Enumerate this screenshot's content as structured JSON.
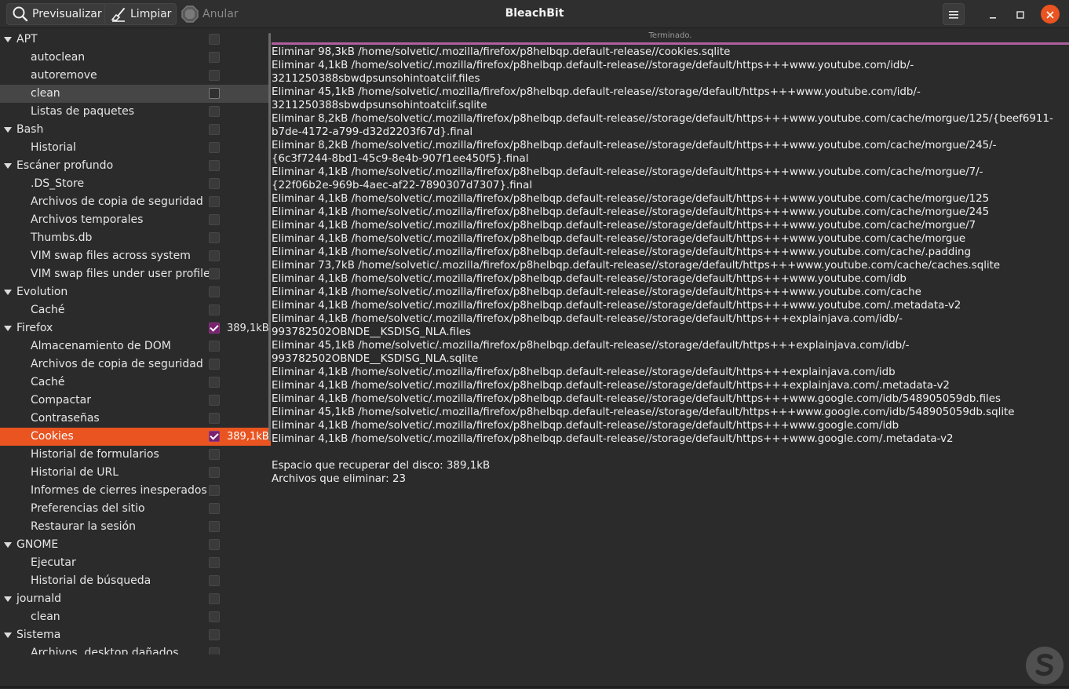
{
  "window": {
    "title": "BleachBit"
  },
  "toolbar": {
    "preview_label": "Previsualizar",
    "clean_label": "Limpiar",
    "abort_label": "Anular"
  },
  "status": {
    "text": "Terminado.",
    "progress": 1.0
  },
  "tree": [
    {
      "type": "parent",
      "label": "APT",
      "checked": false,
      "size": ""
    },
    {
      "type": "child",
      "label": "autoclean",
      "checked": false,
      "size": ""
    },
    {
      "type": "child",
      "label": "autoremove",
      "checked": false,
      "size": ""
    },
    {
      "type": "child",
      "label": "clean",
      "checked": false,
      "size": "",
      "selected": "grey"
    },
    {
      "type": "child",
      "label": "Listas de paquetes",
      "checked": false,
      "size": ""
    },
    {
      "type": "parent",
      "label": "Bash",
      "checked": false,
      "size": ""
    },
    {
      "type": "child",
      "label": "Historial",
      "checked": false,
      "size": ""
    },
    {
      "type": "parent",
      "label": "Escáner profundo",
      "checked": false,
      "size": ""
    },
    {
      "type": "child",
      "label": ".DS_Store",
      "checked": false,
      "size": ""
    },
    {
      "type": "child",
      "label": "Archivos de copia de seguridad",
      "checked": false,
      "size": ""
    },
    {
      "type": "child",
      "label": "Archivos temporales",
      "checked": false,
      "size": ""
    },
    {
      "type": "child",
      "label": "Thumbs.db",
      "checked": false,
      "size": ""
    },
    {
      "type": "child",
      "label": "VIM swap files across system",
      "checked": false,
      "size": ""
    },
    {
      "type": "child",
      "label": "VIM swap files under user profile",
      "checked": false,
      "size": ""
    },
    {
      "type": "parent",
      "label": "Evolution",
      "checked": false,
      "size": ""
    },
    {
      "type": "child",
      "label": "Caché",
      "checked": false,
      "size": ""
    },
    {
      "type": "parent",
      "label": "Firefox",
      "checked": true,
      "size": "389,1kB"
    },
    {
      "type": "child",
      "label": "Almacenamiento de DOM",
      "checked": false,
      "size": ""
    },
    {
      "type": "child",
      "label": "Archivos de copia de seguridad",
      "checked": false,
      "size": ""
    },
    {
      "type": "child",
      "label": "Caché",
      "checked": false,
      "size": ""
    },
    {
      "type": "child",
      "label": "Compactar",
      "checked": false,
      "size": ""
    },
    {
      "type": "child",
      "label": "Contraseñas",
      "checked": false,
      "size": ""
    },
    {
      "type": "child",
      "label": "Cookies",
      "checked": true,
      "size": "389,1kB",
      "selected": "orange"
    },
    {
      "type": "child",
      "label": "Historial de formularios",
      "checked": false,
      "size": ""
    },
    {
      "type": "child",
      "label": "Historial de URL",
      "checked": false,
      "size": ""
    },
    {
      "type": "child",
      "label": "Informes de cierres inesperados",
      "checked": false,
      "size": ""
    },
    {
      "type": "child",
      "label": "Preferencias del sitio",
      "checked": false,
      "size": ""
    },
    {
      "type": "child",
      "label": "Restaurar la sesión",
      "checked": false,
      "size": ""
    },
    {
      "type": "parent",
      "label": "GNOME",
      "checked": false,
      "size": ""
    },
    {
      "type": "child",
      "label": "Ejecutar",
      "checked": false,
      "size": ""
    },
    {
      "type": "child",
      "label": "Historial de búsqueda",
      "checked": false,
      "size": ""
    },
    {
      "type": "parent",
      "label": "journald",
      "checked": false,
      "size": ""
    },
    {
      "type": "child",
      "label": "clean",
      "checked": false,
      "size": ""
    },
    {
      "type": "parent",
      "label": "Sistema",
      "checked": false,
      "size": ""
    },
    {
      "type": "child",
      "label": "Archivos .desktop dañados",
      "checked": false,
      "size": ""
    }
  ],
  "log": {
    "lines": [
      "Eliminar 98,3kB /home/solvetic/.mozilla/firefox/p8helbqp.default-release//cookies.sqlite",
      "Eliminar 4,1kB /home/solvetic/.mozilla/firefox/p8helbqp.default-release//storage/default/https+++www.youtube.com/idb/-",
      "3211250388sbwdpsunsohintoatciif.files",
      "Eliminar 45,1kB /home/solvetic/.mozilla/firefox/p8helbqp.default-release//storage/default/https+++www.youtube.com/idb/-",
      "3211250388sbwdpsunsohintoatciif.sqlite",
      "Eliminar 8,2kB /home/solvetic/.mozilla/firefox/p8helbqp.default-release//storage/default/https+++www.youtube.com/cache/morgue/125/{beef6911-",
      "b7de-4172-a799-d32d2203f67d}.final",
      "Eliminar 8,2kB /home/solvetic/.mozilla/firefox/p8helbqp.default-release//storage/default/https+++www.youtube.com/cache/morgue/245/-",
      "{6c3f7244-8bd1-45c9-8e4b-907f1ee450f5}.final",
      "Eliminar 4,1kB /home/solvetic/.mozilla/firefox/p8helbqp.default-release//storage/default/https+++www.youtube.com/cache/morgue/7/-",
      "{22f06b2e-969b-4aec-af22-7890307d7307}.final",
      "Eliminar 4,1kB /home/solvetic/.mozilla/firefox/p8helbqp.default-release//storage/default/https+++www.youtube.com/cache/morgue/125",
      "Eliminar 4,1kB /home/solvetic/.mozilla/firefox/p8helbqp.default-release//storage/default/https+++www.youtube.com/cache/morgue/245",
      "Eliminar 4,1kB /home/solvetic/.mozilla/firefox/p8helbqp.default-release//storage/default/https+++www.youtube.com/cache/morgue/7",
      "Eliminar 4,1kB /home/solvetic/.mozilla/firefox/p8helbqp.default-release//storage/default/https+++www.youtube.com/cache/morgue",
      "Eliminar 4,1kB /home/solvetic/.mozilla/firefox/p8helbqp.default-release//storage/default/https+++www.youtube.com/cache/.padding",
      "Eliminar 73,7kB /home/solvetic/.mozilla/firefox/p8helbqp.default-release//storage/default/https+++www.youtube.com/cache/caches.sqlite",
      "Eliminar 4,1kB /home/solvetic/.mozilla/firefox/p8helbqp.default-release//storage/default/https+++www.youtube.com/idb",
      "Eliminar 4,1kB /home/solvetic/.mozilla/firefox/p8helbqp.default-release//storage/default/https+++www.youtube.com/cache",
      "Eliminar 4,1kB /home/solvetic/.mozilla/firefox/p8helbqp.default-release//storage/default/https+++www.youtube.com/.metadata-v2",
      "Eliminar 4,1kB /home/solvetic/.mozilla/firefox/p8helbqp.default-release//storage/default/https+++explainjava.com/idb/-",
      "993782502OBNDE__KSDISG_NLA.files",
      "Eliminar 45,1kB /home/solvetic/.mozilla/firefox/p8helbqp.default-release//storage/default/https+++explainjava.com/idb/-",
      "993782502OBNDE__KSDISG_NLA.sqlite",
      "Eliminar 4,1kB /home/solvetic/.mozilla/firefox/p8helbqp.default-release//storage/default/https+++explainjava.com/idb",
      "Eliminar 4,1kB /home/solvetic/.mozilla/firefox/p8helbqp.default-release//storage/default/https+++explainjava.com/.metadata-v2",
      "Eliminar 4,1kB /home/solvetic/.mozilla/firefox/p8helbqp.default-release//storage/default/https+++www.google.com/idb/548905059db.files",
      "Eliminar 45,1kB /home/solvetic/.mozilla/firefox/p8helbqp.default-release//storage/default/https+++www.google.com/idb/548905059db.sqlite",
      "Eliminar 4,1kB /home/solvetic/.mozilla/firefox/p8helbqp.default-release//storage/default/https+++www.google.com/idb",
      "Eliminar 4,1kB /home/solvetic/.mozilla/firefox/p8helbqp.default-release//storage/default/https+++www.google.com/.metadata-v2"
    ],
    "summary": {
      "space_line": "Espacio que recuperar del disco: 389,1kB",
      "files_line": "Archivos que eliminar: 23"
    }
  },
  "icons": {
    "preview": "search-icon",
    "clean": "broom-icon",
    "abort": "stop-icon",
    "menu": "hamburger-menu-icon",
    "minimize": "minimize-icon",
    "maximize": "maximize-icon",
    "close": "close-icon"
  },
  "colors": {
    "accent_orange": "#e95420",
    "check_purple": "#77216f",
    "progress": "#b0609f",
    "background": "#2b2b2b"
  }
}
